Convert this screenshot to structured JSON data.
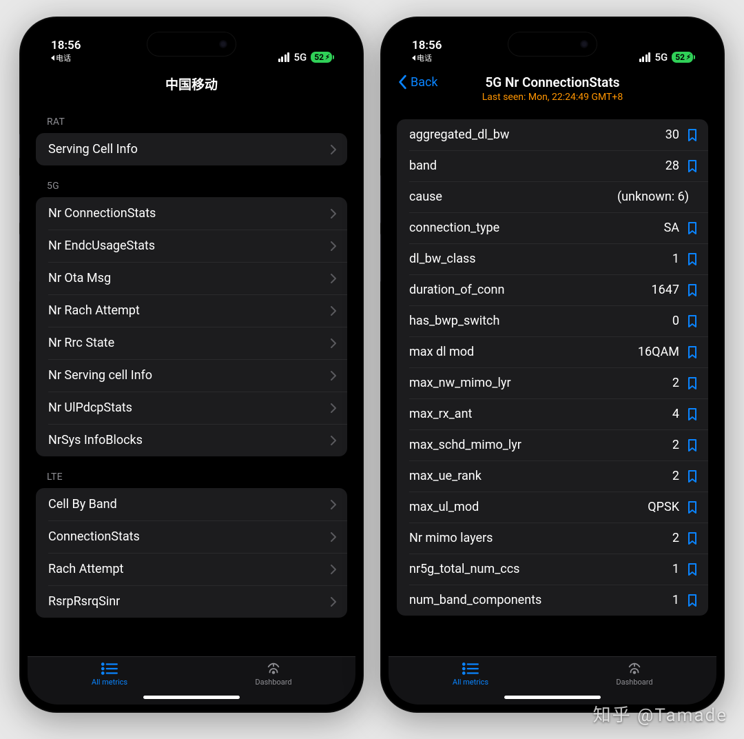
{
  "status": {
    "time": "18:56",
    "back_app": "电话",
    "network": "5G",
    "battery": "52"
  },
  "left_screen": {
    "title": "中国移动",
    "sections": [
      {
        "header": "RAT",
        "items": [
          "Serving Cell Info"
        ]
      },
      {
        "header": "5G",
        "items": [
          "Nr ConnectionStats",
          "Nr EndcUsageStats",
          "Nr Ota Msg",
          "Nr Rach Attempt",
          "Nr Rrc State",
          "Nr Serving cell Info",
          "Nr UlPdcpStats",
          "NrSys InfoBlocks"
        ]
      },
      {
        "header": "LTE",
        "items": [
          "Cell By Band",
          "ConnectionStats",
          "Rach Attempt",
          "RsrpRsrqSinr"
        ]
      }
    ]
  },
  "right_screen": {
    "back_label": "Back",
    "title": "5G Nr ConnectionStats",
    "subtitle": "Last seen: Mon, 22:24:49 GMT+8",
    "stats": [
      {
        "key": "aggregated_dl_bw",
        "val": "30",
        "bm": true
      },
      {
        "key": "band",
        "val": "28",
        "bm": true
      },
      {
        "key": "cause",
        "val": "(unknown: 6)",
        "bm": false
      },
      {
        "key": "connection_type",
        "val": "SA",
        "bm": true
      },
      {
        "key": "dl_bw_class",
        "val": "1",
        "bm": true
      },
      {
        "key": "duration_of_conn",
        "val": "1647",
        "bm": true
      },
      {
        "key": "has_bwp_switch",
        "val": "0",
        "bm": true
      },
      {
        "key": "max dl mod",
        "val": "16QAM",
        "bm": true
      },
      {
        "key": "max_nw_mimo_lyr",
        "val": "2",
        "bm": true
      },
      {
        "key": "max_rx_ant",
        "val": "4",
        "bm": true
      },
      {
        "key": "max_schd_mimo_lyr",
        "val": "2",
        "bm": true
      },
      {
        "key": "max_ue_rank",
        "val": "2",
        "bm": true
      },
      {
        "key": "max_ul_mod",
        "val": "QPSK",
        "bm": true
      },
      {
        "key": "Nr mimo layers",
        "val": "2",
        "bm": true
      },
      {
        "key": "nr5g_total_num_ccs",
        "val": "1",
        "bm": true
      },
      {
        "key": "num_band_components",
        "val": "1",
        "bm": true
      }
    ]
  },
  "tabs": {
    "all_metrics": "All metrics",
    "dashboard": "Dashboard"
  },
  "watermark": "知乎 @Tamade"
}
